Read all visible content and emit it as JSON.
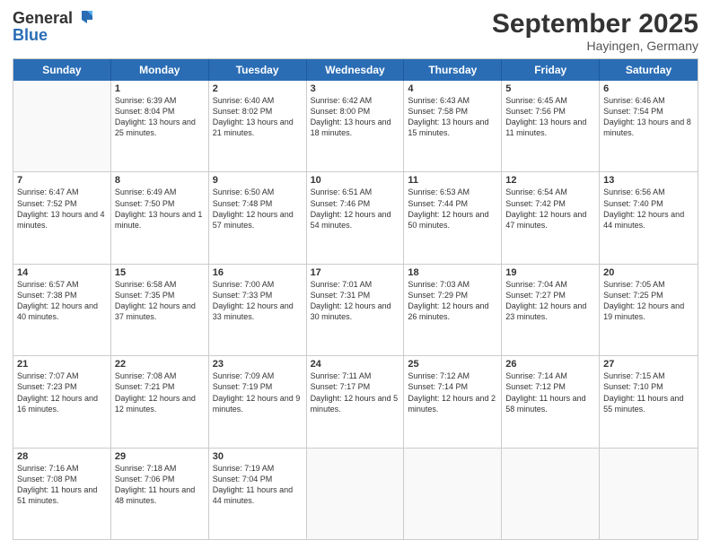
{
  "header": {
    "logo_general": "General",
    "logo_blue": "Blue",
    "month_title": "September 2025",
    "location": "Hayingen, Germany"
  },
  "days_of_week": [
    "Sunday",
    "Monday",
    "Tuesday",
    "Wednesday",
    "Thursday",
    "Friday",
    "Saturday"
  ],
  "rows": [
    [
      {
        "day": "",
        "sunrise": "",
        "sunset": "",
        "daylight": ""
      },
      {
        "day": "1",
        "sunrise": "Sunrise: 6:39 AM",
        "sunset": "Sunset: 8:04 PM",
        "daylight": "Daylight: 13 hours and 25 minutes."
      },
      {
        "day": "2",
        "sunrise": "Sunrise: 6:40 AM",
        "sunset": "Sunset: 8:02 PM",
        "daylight": "Daylight: 13 hours and 21 minutes."
      },
      {
        "day": "3",
        "sunrise": "Sunrise: 6:42 AM",
        "sunset": "Sunset: 8:00 PM",
        "daylight": "Daylight: 13 hours and 18 minutes."
      },
      {
        "day": "4",
        "sunrise": "Sunrise: 6:43 AM",
        "sunset": "Sunset: 7:58 PM",
        "daylight": "Daylight: 13 hours and 15 minutes."
      },
      {
        "day": "5",
        "sunrise": "Sunrise: 6:45 AM",
        "sunset": "Sunset: 7:56 PM",
        "daylight": "Daylight: 13 hours and 11 minutes."
      },
      {
        "day": "6",
        "sunrise": "Sunrise: 6:46 AM",
        "sunset": "Sunset: 7:54 PM",
        "daylight": "Daylight: 13 hours and 8 minutes."
      }
    ],
    [
      {
        "day": "7",
        "sunrise": "Sunrise: 6:47 AM",
        "sunset": "Sunset: 7:52 PM",
        "daylight": "Daylight: 13 hours and 4 minutes."
      },
      {
        "day": "8",
        "sunrise": "Sunrise: 6:49 AM",
        "sunset": "Sunset: 7:50 PM",
        "daylight": "Daylight: 13 hours and 1 minute."
      },
      {
        "day": "9",
        "sunrise": "Sunrise: 6:50 AM",
        "sunset": "Sunset: 7:48 PM",
        "daylight": "Daylight: 12 hours and 57 minutes."
      },
      {
        "day": "10",
        "sunrise": "Sunrise: 6:51 AM",
        "sunset": "Sunset: 7:46 PM",
        "daylight": "Daylight: 12 hours and 54 minutes."
      },
      {
        "day": "11",
        "sunrise": "Sunrise: 6:53 AM",
        "sunset": "Sunset: 7:44 PM",
        "daylight": "Daylight: 12 hours and 50 minutes."
      },
      {
        "day": "12",
        "sunrise": "Sunrise: 6:54 AM",
        "sunset": "Sunset: 7:42 PM",
        "daylight": "Daylight: 12 hours and 47 minutes."
      },
      {
        "day": "13",
        "sunrise": "Sunrise: 6:56 AM",
        "sunset": "Sunset: 7:40 PM",
        "daylight": "Daylight: 12 hours and 44 minutes."
      }
    ],
    [
      {
        "day": "14",
        "sunrise": "Sunrise: 6:57 AM",
        "sunset": "Sunset: 7:38 PM",
        "daylight": "Daylight: 12 hours and 40 minutes."
      },
      {
        "day": "15",
        "sunrise": "Sunrise: 6:58 AM",
        "sunset": "Sunset: 7:35 PM",
        "daylight": "Daylight: 12 hours and 37 minutes."
      },
      {
        "day": "16",
        "sunrise": "Sunrise: 7:00 AM",
        "sunset": "Sunset: 7:33 PM",
        "daylight": "Daylight: 12 hours and 33 minutes."
      },
      {
        "day": "17",
        "sunrise": "Sunrise: 7:01 AM",
        "sunset": "Sunset: 7:31 PM",
        "daylight": "Daylight: 12 hours and 30 minutes."
      },
      {
        "day": "18",
        "sunrise": "Sunrise: 7:03 AM",
        "sunset": "Sunset: 7:29 PM",
        "daylight": "Daylight: 12 hours and 26 minutes."
      },
      {
        "day": "19",
        "sunrise": "Sunrise: 7:04 AM",
        "sunset": "Sunset: 7:27 PM",
        "daylight": "Daylight: 12 hours and 23 minutes."
      },
      {
        "day": "20",
        "sunrise": "Sunrise: 7:05 AM",
        "sunset": "Sunset: 7:25 PM",
        "daylight": "Daylight: 12 hours and 19 minutes."
      }
    ],
    [
      {
        "day": "21",
        "sunrise": "Sunrise: 7:07 AM",
        "sunset": "Sunset: 7:23 PM",
        "daylight": "Daylight: 12 hours and 16 minutes."
      },
      {
        "day": "22",
        "sunrise": "Sunrise: 7:08 AM",
        "sunset": "Sunset: 7:21 PM",
        "daylight": "Daylight: 12 hours and 12 minutes."
      },
      {
        "day": "23",
        "sunrise": "Sunrise: 7:09 AM",
        "sunset": "Sunset: 7:19 PM",
        "daylight": "Daylight: 12 hours and 9 minutes."
      },
      {
        "day": "24",
        "sunrise": "Sunrise: 7:11 AM",
        "sunset": "Sunset: 7:17 PM",
        "daylight": "Daylight: 12 hours and 5 minutes."
      },
      {
        "day": "25",
        "sunrise": "Sunrise: 7:12 AM",
        "sunset": "Sunset: 7:14 PM",
        "daylight": "Daylight: 12 hours and 2 minutes."
      },
      {
        "day": "26",
        "sunrise": "Sunrise: 7:14 AM",
        "sunset": "Sunset: 7:12 PM",
        "daylight": "Daylight: 11 hours and 58 minutes."
      },
      {
        "day": "27",
        "sunrise": "Sunrise: 7:15 AM",
        "sunset": "Sunset: 7:10 PM",
        "daylight": "Daylight: 11 hours and 55 minutes."
      }
    ],
    [
      {
        "day": "28",
        "sunrise": "Sunrise: 7:16 AM",
        "sunset": "Sunset: 7:08 PM",
        "daylight": "Daylight: 11 hours and 51 minutes."
      },
      {
        "day": "29",
        "sunrise": "Sunrise: 7:18 AM",
        "sunset": "Sunset: 7:06 PM",
        "daylight": "Daylight: 11 hours and 48 minutes."
      },
      {
        "day": "30",
        "sunrise": "Sunrise: 7:19 AM",
        "sunset": "Sunset: 7:04 PM",
        "daylight": "Daylight: 11 hours and 44 minutes."
      },
      {
        "day": "",
        "sunrise": "",
        "sunset": "",
        "daylight": ""
      },
      {
        "day": "",
        "sunrise": "",
        "sunset": "",
        "daylight": ""
      },
      {
        "day": "",
        "sunrise": "",
        "sunset": "",
        "daylight": ""
      },
      {
        "day": "",
        "sunrise": "",
        "sunset": "",
        "daylight": ""
      }
    ]
  ]
}
